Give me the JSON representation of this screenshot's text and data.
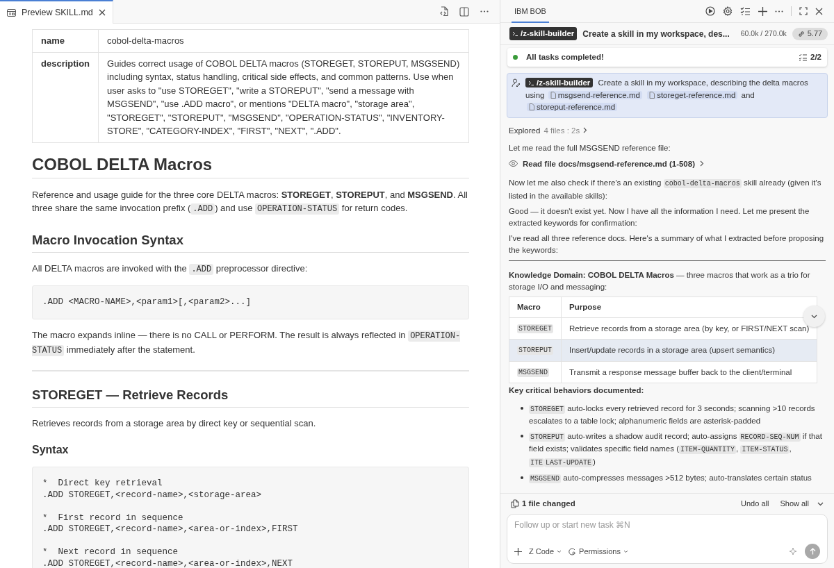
{
  "editor": {
    "tab": {
      "label": "Preview SKILL.md",
      "selected": true
    }
  },
  "preview": {
    "front_matter": [
      {
        "key": "name",
        "value": "cobol-delta-macros"
      },
      {
        "key": "description",
        "value": "Guides correct usage of COBOL DELTA macros (STOREGET, STOREPUT, MSGSEND) including syntax, status handling, critical side effects, and common patterns. Use when user asks to \"use STOREGET\", \"write a STOREPUT\", \"send a message with MSGSEND\", \"use .ADD macro\", or mentions \"DELTA macro\", \"storage area\", \"STOREGET\", \"STOREPUT\", \"MSGSEND\", \"OPERATION-STATUS\", \"INVENTORY-STORE\", \"CATEGORY-INDEX\", \"FIRST\", \"NEXT\", \".ADD\"."
      }
    ],
    "blocks": [
      {
        "kind": "h1",
        "text": "COBOL DELTA Macros"
      },
      {
        "kind": "p",
        "segments": [
          {
            "kind": "text",
            "text": "Reference and usage guide for the three core DELTA macros: **STOREGET**, **STOREPUT**, and **MSGSEND**. All three share the same invocation prefix ("
          },
          {
            "kind": "code",
            "text": ".ADD"
          },
          {
            "kind": "text",
            "text": ") and use "
          },
          {
            "kind": "code",
            "text": "OPERATION-STATUS"
          },
          {
            "kind": "text",
            "text": " for return codes."
          }
        ]
      },
      {
        "kind": "h2",
        "text": "Macro Invocation Syntax"
      },
      {
        "kind": "p",
        "segments": [
          {
            "kind": "text",
            "text": "All DELTA macros are invoked with the "
          },
          {
            "kind": "code",
            "text": ".ADD"
          },
          {
            "kind": "text",
            "text": " preprocessor directive:"
          }
        ]
      },
      {
        "kind": "code",
        "groups": [
          [
            ".ADD <MACRO-NAME>,<param1>[,<param2>...]"
          ]
        ]
      },
      {
        "kind": "p",
        "segments": [
          {
            "kind": "text",
            "text": "The macro expands inline — there is no CALL or PERFORM. The result is always reflected in "
          },
          {
            "kind": "code",
            "text": "OPERATION-STATUS"
          },
          {
            "kind": "text",
            "text": " immediately after the statement."
          }
        ]
      },
      {
        "kind": "hr"
      },
      {
        "kind": "h2",
        "text": "STOREGET — Retrieve Records"
      },
      {
        "kind": "p",
        "segments": [
          {
            "kind": "text",
            "text": "Retrieves records from a storage area by direct key or sequential scan."
          }
        ]
      },
      {
        "kind": "h3",
        "text": "Syntax"
      },
      {
        "kind": "code",
        "groups": [
          [
            "*  Direct key retrieval",
            ".ADD STOREGET,<record-name>,<storage-area>"
          ],
          [
            "*  First record in sequence",
            ".ADD STOREGET,<record-name>,<area-or-index>,FIRST"
          ],
          [
            "*  Next record in sequence",
            ".ADD STOREGET,<record-name>,<area-or-index>,NEXT"
          ]
        ]
      }
    ]
  },
  "chat": {
    "tab": {
      "label": "IBM BOB",
      "selected": true
    },
    "task": {
      "command": "/z-skill-builder",
      "title": "Create a skill in my workspace, des...",
      "tokens": "60.0k / 270.0k",
      "cost": "5.77"
    },
    "todo": {
      "text": "All tasks completed!",
      "count": "2/2",
      "color": "#3a9b3a"
    },
    "user_message": [
      {
        "kind": "command",
        "text": "/z-skill-builder"
      },
      {
        "kind": "text",
        "text": "Create a skill in my workspace, describing the delta macros using"
      },
      {
        "kind": "file",
        "text": "msgsend-reference.md"
      },
      {
        "kind": "file",
        "text": "storeget-reference.md"
      },
      {
        "kind": "text",
        "text": "and"
      },
      {
        "kind": "file",
        "text": "storeput-reference.md"
      }
    ],
    "messages": [
      {
        "kind": "explored",
        "label": "Explored",
        "detail": "4 files : 2s"
      },
      {
        "kind": "p",
        "segments": [
          {
            "kind": "text",
            "text": "Let me read the full MSGSEND reference file:"
          }
        ]
      },
      {
        "kind": "tool",
        "text": "Read file docs/msgsend-reference.md (1-508)"
      },
      {
        "kind": "p",
        "segments": [
          {
            "kind": "text",
            "text": "Now let me also check if there's an existing "
          },
          {
            "kind": "code",
            "text": "cobol-delta-macros"
          },
          {
            "kind": "text",
            "text": " skill already (given it's listed in the available skills):"
          }
        ]
      },
      {
        "kind": "p",
        "segments": [
          {
            "kind": "text",
            "text": "Good — it doesn't exist yet. Now I have all the information I need. Let me present the extracted keywords for confirmation:"
          }
        ]
      },
      {
        "kind": "p",
        "segments": [
          {
            "kind": "text",
            "text": "I've read all three reference docs. Here's a summary of what I extracted before proposing the keywords:"
          }
        ]
      },
      {
        "kind": "hr"
      },
      {
        "kind": "p",
        "segments": [
          {
            "kind": "text",
            "text": "**Knowledge Domain: COBOL DELTA Macros** — three macros that work as a trio for storage I/O and messaging:"
          }
        ]
      },
      {
        "kind": "table",
        "columns": [
          "Macro",
          "Purpose"
        ],
        "rows": [
          {
            "macro": "STOREGET",
            "purpose": "Retrieve records from a storage area (by key, or FIRST/NEXT scan)",
            "selected": false
          },
          {
            "macro": "STOREPUT",
            "purpose": "Insert/update records in a storage area (upsert semantics)",
            "selected": true
          },
          {
            "macro": "MSGSEND",
            "purpose": "Transmit a response message buffer back to the client/terminal",
            "selected": false
          }
        ]
      },
      {
        "kind": "h",
        "text": "Key critical behaviors documented:"
      },
      {
        "kind": "bullets",
        "items": [
          [
            {
              "kind": "code",
              "text": "STOREGET"
            },
            {
              "kind": "text",
              "text": " auto-locks every retrieved record for 3 seconds; scanning >10 records escalates to a table lock; alphanumeric fields are asterisk-padded"
            }
          ],
          [
            {
              "kind": "code",
              "text": "STOREPUT"
            },
            {
              "kind": "text",
              "text": " auto-writes a shadow audit record; auto-assigns "
            },
            {
              "kind": "code",
              "text": "RECORD-SEQ-NUM"
            },
            {
              "kind": "text",
              "text": " if that field exists; validates specific field names ("
            },
            {
              "kind": "code",
              "text": "ITEM-QUANTITY"
            },
            {
              "kind": "text",
              "text": ", "
            },
            {
              "kind": "code",
              "text": "ITEM-STATUS"
            },
            {
              "kind": "text",
              "text": ", "
            },
            {
              "kind": "code",
              "text": "ITE"
            },
            {
              "kind": "code",
              "text": "LAST-UPDATE"
            },
            {
              "kind": "text",
              "text": ")"
            }
          ],
          [
            {
              "kind": "code",
              "text": "MSGSEND"
            },
            {
              "kind": "text",
              "text": " auto-compresses messages >512 bytes; auto-translates certain status"
            }
          ]
        ]
      }
    ],
    "changes": {
      "text": "1 file changed",
      "undo": "Undo all",
      "show": "Show all"
    },
    "input": {
      "placeholder": "Follow up or start new task ⌘N",
      "mode": "Z Code",
      "permissions": "Permissions"
    }
  }
}
